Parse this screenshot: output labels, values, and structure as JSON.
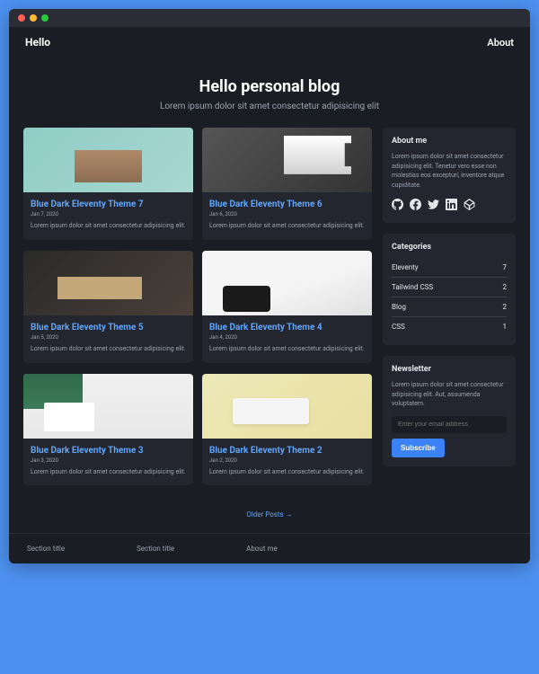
{
  "nav": {
    "brand": "Hello",
    "about": "About"
  },
  "hero": {
    "title": "Hello personal blog",
    "subtitle": "Lorem ipsum dolor sit amet consectetur adipisicing elit"
  },
  "posts": [
    {
      "title": "Blue Dark Eleventy Theme 7",
      "date": "Jan 7, 2020",
      "excerpt": "Lorem ipsum dolor sit amet consectetur adipisicing elit."
    },
    {
      "title": "Blue Dark Eleventy Theme 6",
      "date": "Jan 6, 2020",
      "excerpt": "Lorem ipsum dolor sit amet consectetur adipisicing elit."
    },
    {
      "title": "Blue Dark Eleventy Theme 5",
      "date": "Jan 5, 2020",
      "excerpt": "Lorem ipsum dolor sit amet consectetur adipisicing elit."
    },
    {
      "title": "Blue Dark Eleventy Theme 4",
      "date": "Jan 4, 2020",
      "excerpt": "Lorem ipsum dolor sit amet consectetur adipisicing elit."
    },
    {
      "title": "Blue Dark Eleventy Theme 3",
      "date": "Jan 3, 2020",
      "excerpt": "Lorem ipsum dolor sit amet consectetur adipisicing elit."
    },
    {
      "title": "Blue Dark Eleventy Theme 2",
      "date": "Jan 2, 2020",
      "excerpt": "Lorem ipsum dolor sit amet consectetur adipisicing elit."
    }
  ],
  "pagination": {
    "older": "Older Posts →"
  },
  "sidebar": {
    "about": {
      "title": "About me",
      "text": "Lorem ipsum dolor sit amet consectetur adipisicing elit. Tenetur vero esse non molestias eos excepturi, inventore atque cupiditate."
    },
    "categories": {
      "title": "Categories",
      "items": [
        {
          "name": "Eleventy",
          "count": "7"
        },
        {
          "name": "Tailwind CSS",
          "count": "2"
        },
        {
          "name": "Blog",
          "count": "2"
        },
        {
          "name": "CSS",
          "count": "1"
        }
      ]
    },
    "newsletter": {
      "title": "Newsletter",
      "text": "Lorem ipsum dolor sit amet consectetur adipisicing elit. Aut, assumenda voluptatem.",
      "placeholder": "Enter your email address",
      "button": "Subscribe"
    }
  },
  "footer": {
    "col1": "Section title",
    "col2": "Section title",
    "col3": "About me"
  }
}
